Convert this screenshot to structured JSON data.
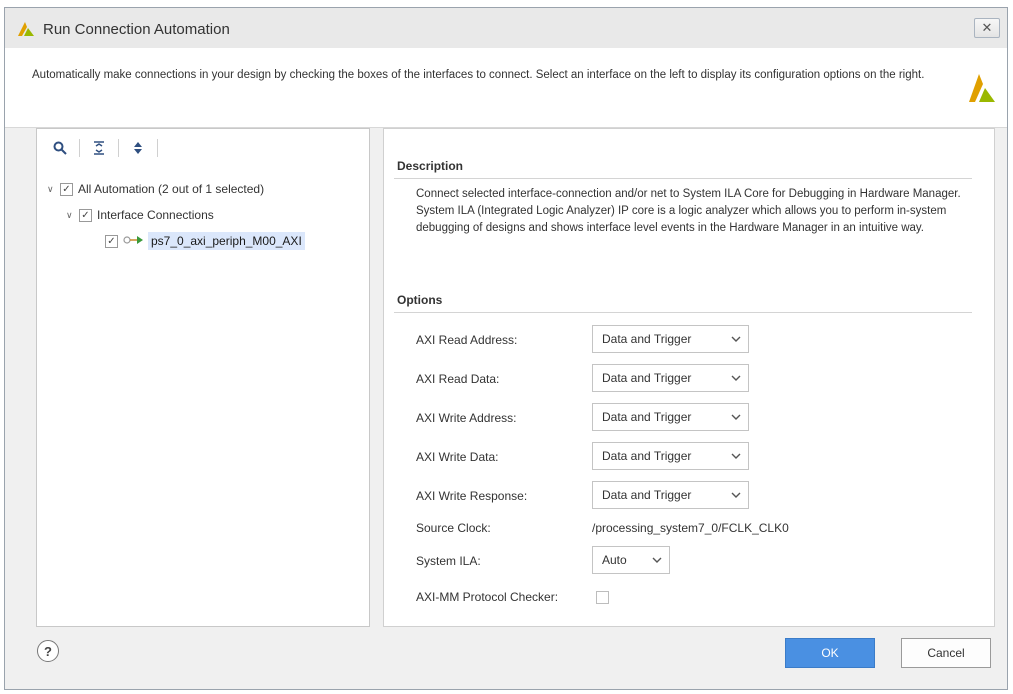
{
  "window": {
    "title": "Run Connection Automation",
    "close_label": "✕"
  },
  "header": {
    "description": "Automatically make connections in your design by checking the boxes of the interfaces to connect. Select an interface on the left to display its configuration options on the right."
  },
  "tree": {
    "root": {
      "label": "All Automation (2 out of 1 selected)",
      "checked": true
    },
    "group": {
      "label": "Interface Connections",
      "checked": true
    },
    "item": {
      "label": "ps7_0_axi_periph_M00_AXI",
      "checked": true,
      "icon": "interface-connector-icon"
    }
  },
  "description_section": {
    "title": "Description",
    "text": "Connect selected interface-connection and/or net to System ILA Core for Debugging in Hardware Manager. System ILA (Integrated Logic Analyzer) IP core is a logic analyzer which allows you to perform in-system debugging of designs and shows interface level events in the Hardware Manager in an intuitive way."
  },
  "options": {
    "title": "Options",
    "axi_read_address": {
      "label": "AXI Read Address:",
      "value": "Data and Trigger"
    },
    "axi_read_data": {
      "label": "AXI Read Data:",
      "value": "Data and Trigger"
    },
    "axi_write_address": {
      "label": "AXI Write Address:",
      "value": "Data and Trigger"
    },
    "axi_write_data": {
      "label": "AXI Write Data:",
      "value": "Data and Trigger"
    },
    "axi_write_response": {
      "label": "AXI Write Response:",
      "value": "Data and Trigger"
    },
    "source_clock": {
      "label": "Source Clock:",
      "value": "/processing_system7_0/FCLK_CLK0"
    },
    "system_ila": {
      "label": "System ILA:",
      "value": "Auto"
    },
    "protocol_checker": {
      "label": "AXI-MM Protocol Checker:",
      "checked": false
    }
  },
  "footer": {
    "help_label": "?",
    "ok_label": "OK",
    "cancel_label": "Cancel"
  },
  "colors": {
    "ok_button": "#4a90e2",
    "selection": "#dbe7fb"
  }
}
